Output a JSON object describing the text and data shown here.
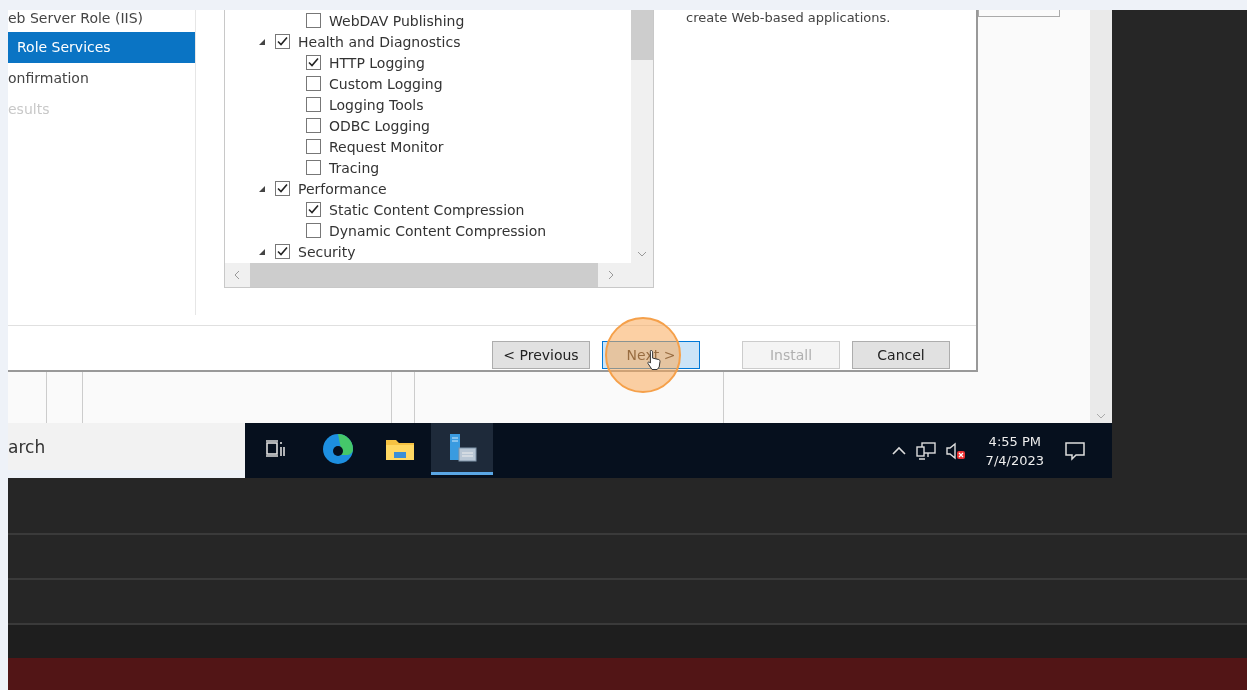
{
  "wizard": {
    "nav_items": [
      {
        "label": "eb Server Role (IIS)",
        "selected": false,
        "disabled": false
      },
      {
        "label": "Role Services",
        "selected": true,
        "disabled": false
      },
      {
        "label": "onfirmation",
        "selected": false,
        "disabled": false
      },
      {
        "label": "esults",
        "selected": false,
        "disabled": true
      }
    ],
    "role_tree": {
      "partial_children": [
        {
          "label": "WebDAV Publishing",
          "checked": false
        }
      ],
      "items": [
        {
          "label": "Health and Diagnostics",
          "checked": true,
          "expanded": true,
          "children": [
            {
              "label": "HTTP Logging",
              "checked": true
            },
            {
              "label": "Custom Logging",
              "checked": false
            },
            {
              "label": "Logging Tools",
              "checked": false
            },
            {
              "label": "ODBC Logging",
              "checked": false
            },
            {
              "label": "Request Monitor",
              "checked": false
            },
            {
              "label": "Tracing",
              "checked": false
            }
          ]
        },
        {
          "label": "Performance",
          "checked": true,
          "expanded": true,
          "children": [
            {
              "label": "Static Content Compression",
              "checked": true
            },
            {
              "label": "Dynamic Content Compression",
              "checked": false
            }
          ]
        },
        {
          "label": "Security",
          "checked": true,
          "expanded": true
        }
      ]
    },
    "description": "create Web-based applications.",
    "buttons": [
      {
        "label": "< Previous",
        "disabled": false,
        "focused": false
      },
      {
        "label": "Next >",
        "disabled": false,
        "focused": true
      },
      {
        "label": "Install",
        "disabled": true,
        "focused": false
      },
      {
        "label": "Cancel",
        "disabled": false,
        "focused": false
      }
    ]
  },
  "search_box": {
    "text": "arch"
  },
  "taskbar": {
    "apps": [
      {
        "kind": "taskview",
        "active": false
      },
      {
        "kind": "edge",
        "active": false
      },
      {
        "kind": "explorer",
        "active": false
      },
      {
        "kind": "servermanager",
        "active": true
      }
    ],
    "clock": {
      "time": "4:55 PM",
      "date": "7/4/2023"
    }
  }
}
